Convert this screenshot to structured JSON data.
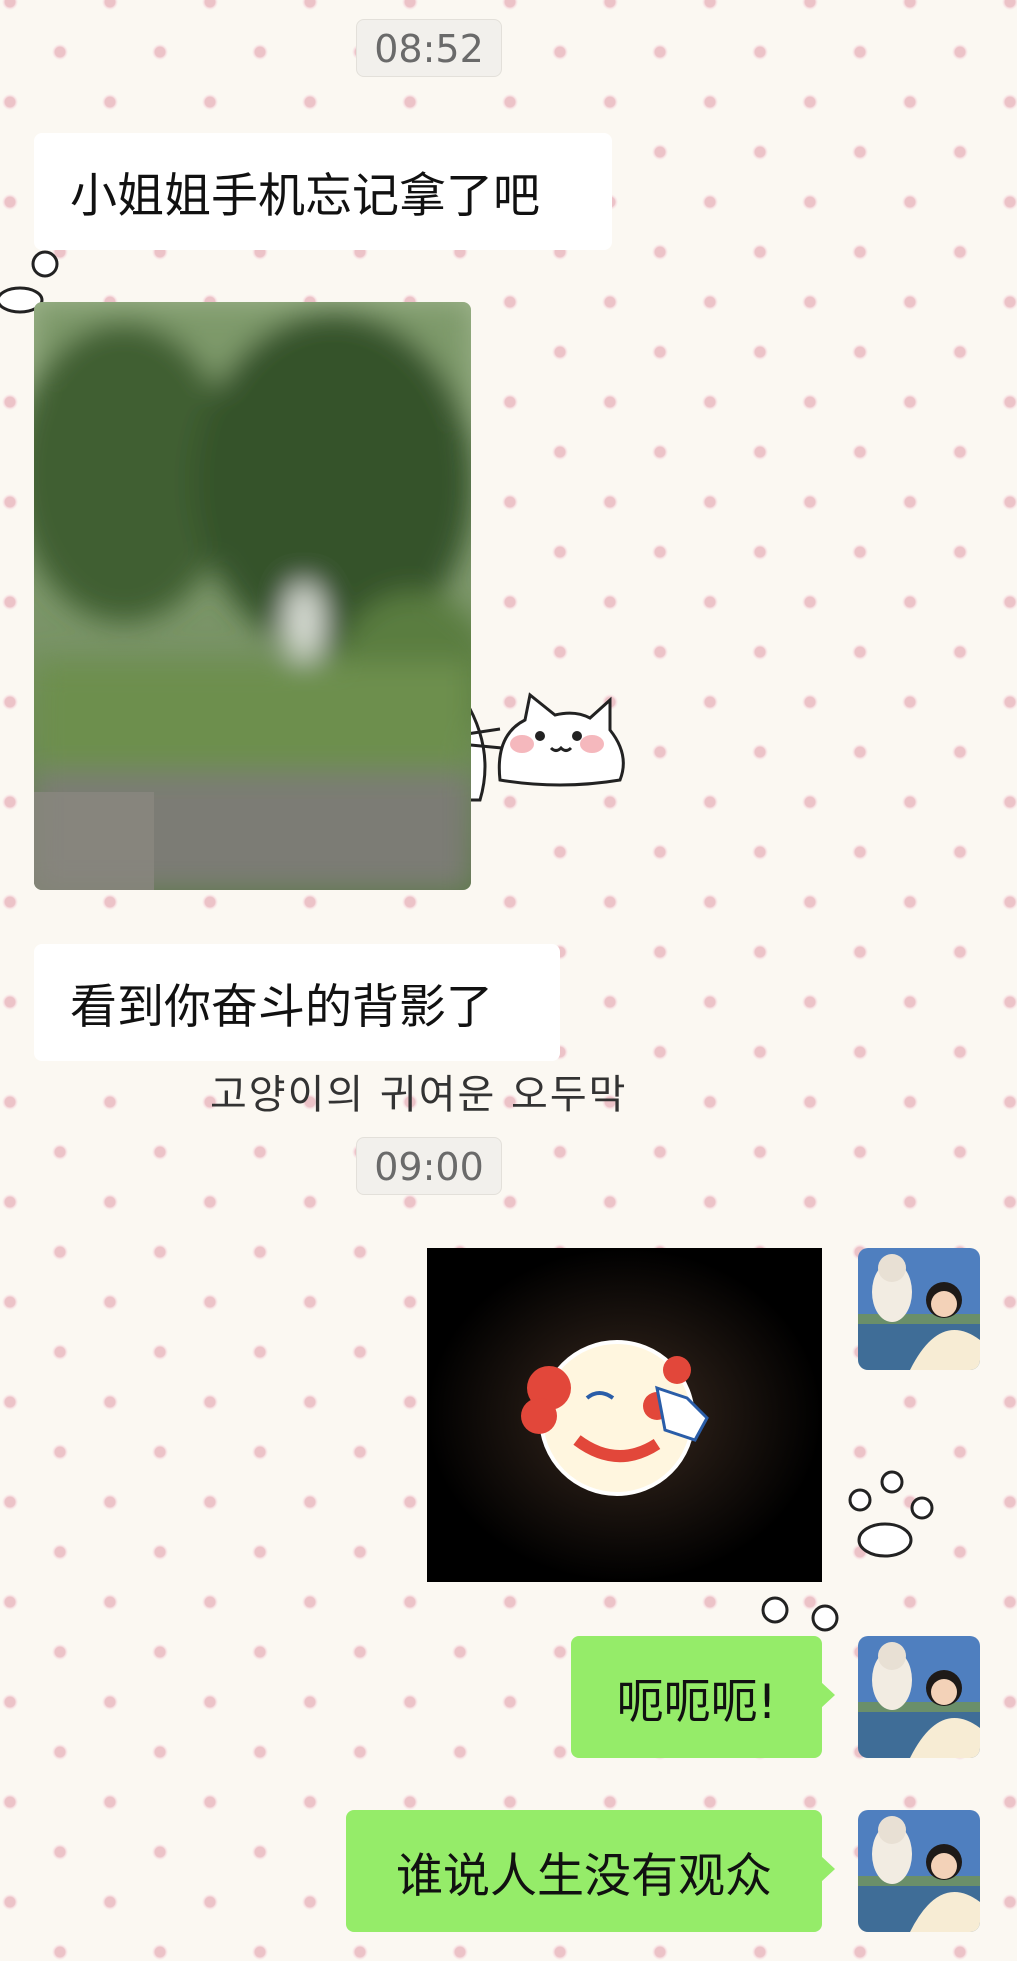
{
  "timestamps": {
    "first": "08:52",
    "second": "09:00"
  },
  "messages": {
    "incoming_1": "小姐姐手机忘记拿了吧",
    "incoming_2": "看到你奋斗的背影了",
    "outgoing_1": "呃呃呃!",
    "outgoing_2": "谁说人生没有观众"
  },
  "wallpaper": {
    "caption": "고양이의 귀여운 오두막"
  },
  "colors": {
    "outgoing_bubble": "#95ec69",
    "incoming_bubble": "#ffffff",
    "wallpaper_bg": "#fbf8f2",
    "wallpaper_dots": "#ecc3c8"
  },
  "icons": {
    "received_photo": "blurred-park-photo",
    "sticker": "clown-face-sticker",
    "avatar": "user-avatar"
  }
}
